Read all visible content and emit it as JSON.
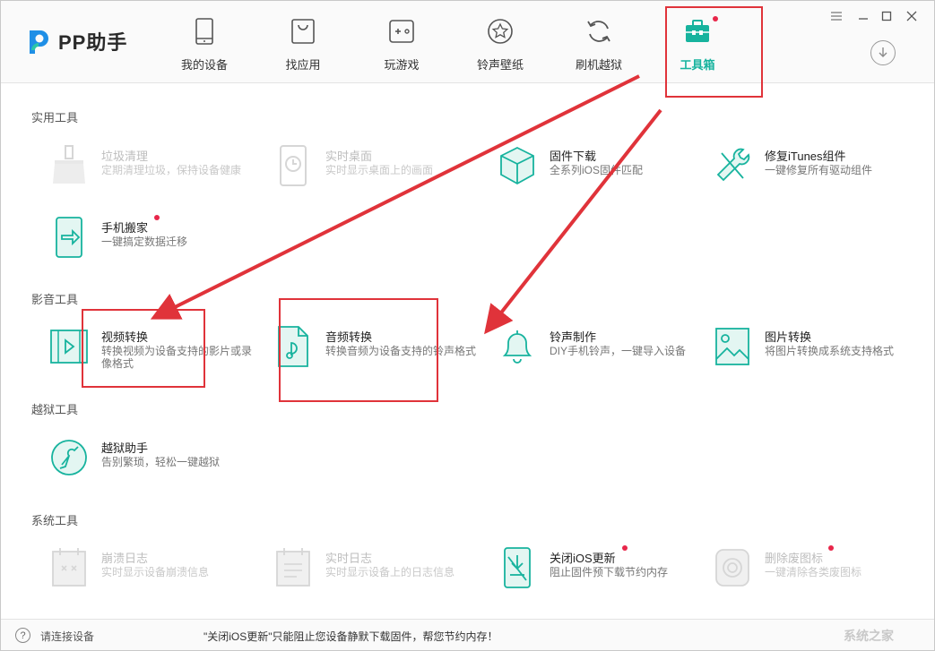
{
  "app": {
    "logo_text": "PP助手"
  },
  "nav": {
    "items": [
      {
        "label": "我的设备",
        "icon": "phone-icon"
      },
      {
        "label": "找应用",
        "icon": "bag-icon"
      },
      {
        "label": "玩游戏",
        "icon": "gamepad-icon"
      },
      {
        "label": "铃声壁纸",
        "icon": "star-icon"
      },
      {
        "label": "刷机越狱",
        "icon": "refresh-icon"
      },
      {
        "label": "工具箱",
        "icon": "toolbox-icon",
        "active": true,
        "badge": true
      }
    ]
  },
  "colors": {
    "accent": "#17b39e",
    "badge": "#e8264a",
    "annotation": "#e0333a"
  },
  "sections": {
    "practical": {
      "title": "实用工具",
      "tools": [
        {
          "name": "垃圾清理",
          "desc": "定期清理垃圾，保持设备健康",
          "icon": "broom-icon",
          "disabled": true
        },
        {
          "name": "实时桌面",
          "desc": "实时显示桌面上的画面",
          "icon": "phone-clock-icon",
          "disabled": true
        },
        {
          "name": "固件下载",
          "desc": "全系列iOS固件匹配",
          "icon": "cube-icon",
          "disabled": false
        },
        {
          "name": "修复iTunes组件",
          "desc": "一键修复所有驱动组件",
          "icon": "wrench-icon",
          "disabled": false
        },
        {
          "name": "手机搬家",
          "desc": "一键搞定数据迁移",
          "icon": "phone-transfer-icon",
          "disabled": false,
          "badge": true
        }
      ]
    },
    "media": {
      "title": "影音工具",
      "tools": [
        {
          "name": "视频转换",
          "desc": "转换视频为设备支持的影片或录像格式",
          "icon": "video-icon",
          "disabled": false
        },
        {
          "name": "音频转换",
          "desc": "转换音频为设备支持的铃声格式",
          "icon": "audio-file-icon",
          "disabled": false
        },
        {
          "name": "铃声制作",
          "desc": "DIY手机铃声，一键导入设备",
          "icon": "bell-icon",
          "disabled": false
        },
        {
          "name": "图片转换",
          "desc": "将图片转换成系统支持格式",
          "icon": "picture-icon",
          "disabled": false
        }
      ]
    },
    "jailbreak": {
      "title": "越狱工具",
      "tools": [
        {
          "name": "越狱助手",
          "desc": "告别繁琐，轻松一键越狱",
          "icon": "jailbreak-icon",
          "disabled": false
        }
      ]
    },
    "system": {
      "title": "系统工具",
      "tools": [
        {
          "name": "崩溃日志",
          "desc": "实时显示设备崩溃信息",
          "icon": "crash-log-icon",
          "disabled": true
        },
        {
          "name": "实时日志",
          "desc": "实时显示设备上的日志信息",
          "icon": "log-icon",
          "disabled": true
        },
        {
          "name": "关闭iOS更新",
          "desc": "阻止固件预下载节约内存",
          "icon": "block-update-icon",
          "disabled": false,
          "badge": true
        },
        {
          "name": "删除废图标",
          "desc": "一键清除各类废图标",
          "icon": "delete-icon-icon",
          "disabled": true,
          "badge": true
        }
      ]
    }
  },
  "footer": {
    "help_glyph": "?",
    "status": "请连接设备",
    "tip": "\"关闭iOS更新\"只能阻止您设备静默下载固件，帮您节约内存！",
    "watermark": "系统之家"
  }
}
